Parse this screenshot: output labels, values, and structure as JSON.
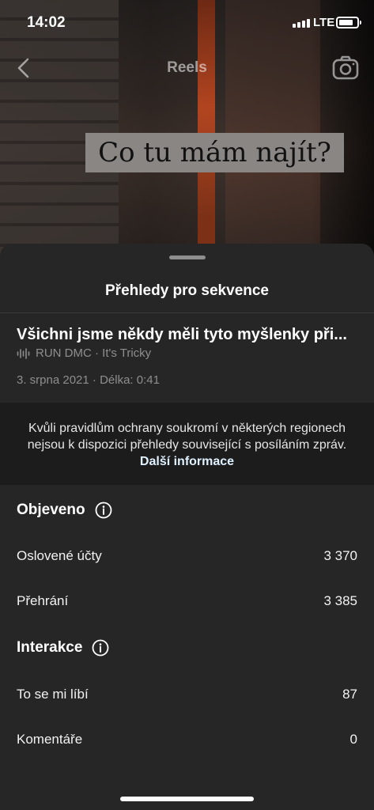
{
  "status_bar": {
    "time": "14:02",
    "network": "LTE"
  },
  "nav": {
    "title": "Reels"
  },
  "reel_caption": "Co tu mám najít?",
  "sheet": {
    "title": "Přehledy pro sekvence",
    "reel_title": "Všichni jsme někdy měli tyto myšlenky při...",
    "audio": "RUN DMC · It's Tricky",
    "meta": "3. srpna 2021 · Délka: 0:41",
    "notice": {
      "text": "Kvůli pravidlům ochrany soukromí v některých regionech nejsou k dispozici přehledy související s posíláním zpráv.",
      "link": "Další informace"
    },
    "discovery": {
      "title": "Objeveno",
      "rows": [
        {
          "label": "Oslovené účty",
          "value": "3 370"
        },
        {
          "label": "Přehrání",
          "value": "3 385"
        }
      ]
    },
    "interactions": {
      "title": "Interakce",
      "rows": [
        {
          "label": "To se mi líbí",
          "value": "87"
        },
        {
          "label": "Komentáře",
          "value": "0"
        }
      ]
    }
  },
  "icons": {
    "back": "chevron-left-icon",
    "camera": "camera-icon",
    "info": "info-icon",
    "audio": "audio-waveform-icon",
    "signal": "cellular-signal-icon",
    "battery": "battery-icon"
  }
}
